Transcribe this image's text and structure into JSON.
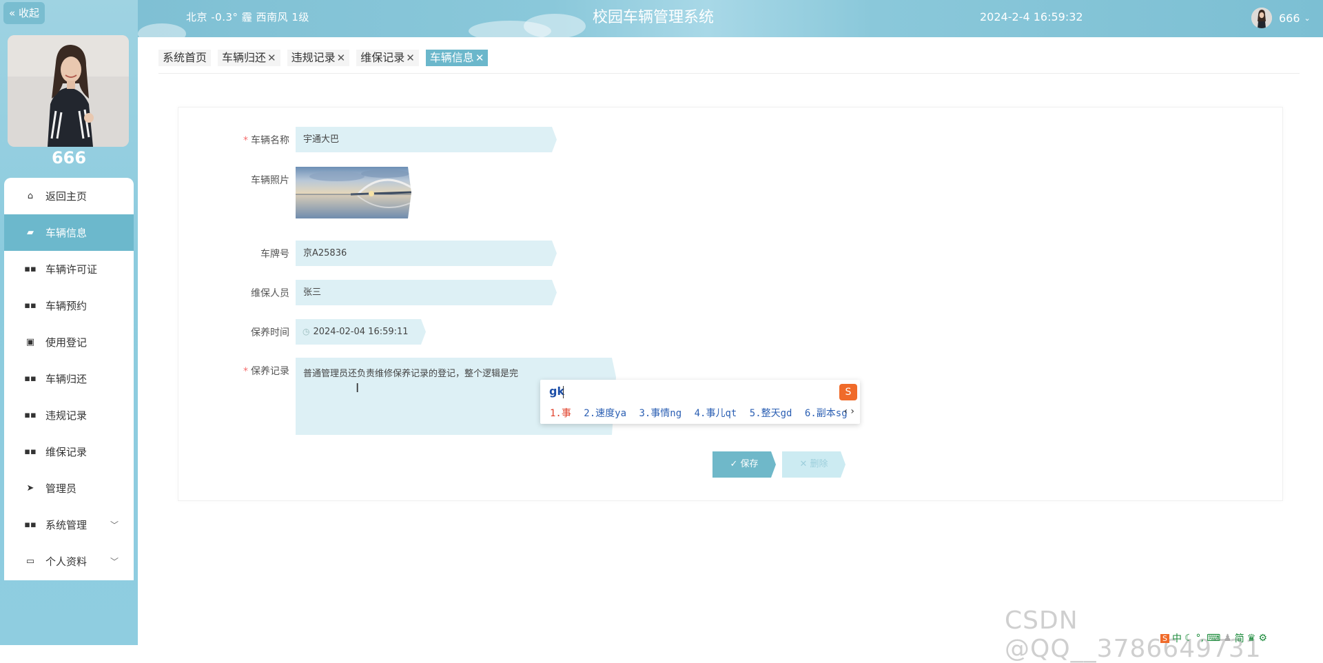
{
  "sidebar": {
    "collapse_label": "« 收起",
    "user_name": "666",
    "items": [
      {
        "label": "返回主页",
        "icon": "home-icon"
      },
      {
        "label": "车辆信息",
        "icon": "message-icon"
      },
      {
        "label": "车辆许可证",
        "icon": "grid-icon"
      },
      {
        "label": "车辆预约",
        "icon": "grid-icon"
      },
      {
        "label": "使用登记",
        "icon": "clipboard-check-icon"
      },
      {
        "label": "车辆归还",
        "icon": "grid-icon"
      },
      {
        "label": "违规记录",
        "icon": "grid-icon"
      },
      {
        "label": "维保记录",
        "icon": "grid-icon"
      },
      {
        "label": "管理员",
        "icon": "send-icon"
      },
      {
        "label": "系统管理",
        "icon": "grid-icon"
      },
      {
        "label": "个人资料",
        "icon": "card-icon"
      }
    ]
  },
  "header": {
    "weather": "北京  -0.3°  霾  西南风  1级",
    "title": "校园车辆管理系统",
    "datetime": "2024-2-4 16:59:32",
    "user": "666"
  },
  "tabs": [
    {
      "label": "系统首页",
      "closable": false
    },
    {
      "label": "车辆归还",
      "closable": true
    },
    {
      "label": "违规记录",
      "closable": true
    },
    {
      "label": "维保记录",
      "closable": true
    },
    {
      "label": "车辆信息",
      "closable": true,
      "active": true
    }
  ],
  "tab_close_glyph": "✕",
  "form": {
    "vehicle_name_label": "车辆名称",
    "vehicle_name_value": "宇通大巴",
    "vehicle_photo_label": "车辆照片",
    "plate_label": "车牌号",
    "plate_value": "京A25836",
    "maintainer_label": "维保人员",
    "maintainer_value": "张三",
    "time_label": "保养时间",
    "time_value": "2024-02-04 16:59:11",
    "record_label": "保养记录",
    "record_value": "普通管理员还负责维修保养记录的登记，整个逻辑是完",
    "required_mark": "*",
    "save_label": "✓ 保存",
    "delete_label": "✕ 删除"
  },
  "ime": {
    "input": "gk",
    "candidates": [
      "1.事",
      "2.速度ya",
      "3.事情ng",
      "4.事儿qt",
      "5.整天gd",
      "6.副本sg"
    ],
    "next": "‹ ›"
  },
  "watermark": "CSDN @QQ__3786649731",
  "tray": {
    "lang": "中",
    "simplified": "简"
  },
  "colors": {
    "accent": "#6cb8cc",
    "sidebar_bg": "#8fcde0",
    "input_bg": "#ddf0f5",
    "required": "#f56c6c"
  }
}
